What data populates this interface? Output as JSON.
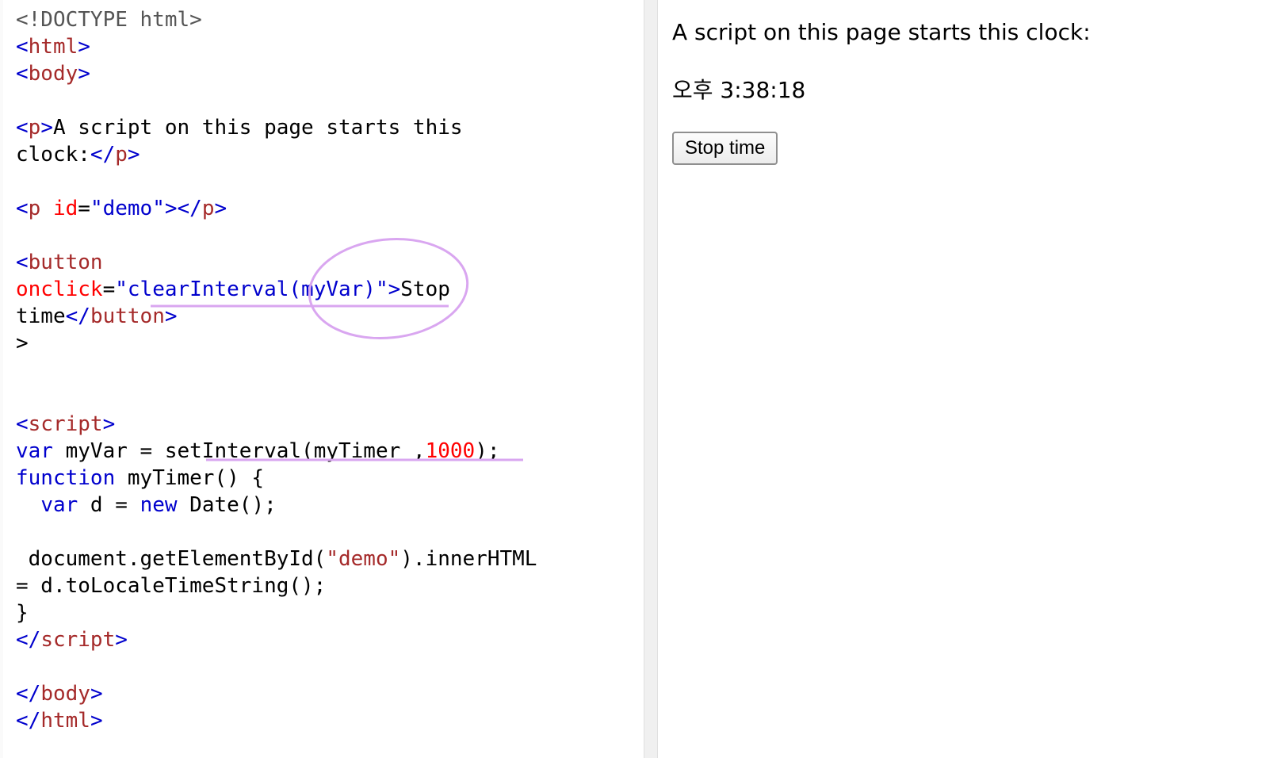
{
  "editor": {
    "lines": [
      [
        {
          "t": "<!DOCTYPE html>",
          "c": "doctype"
        }
      ],
      [
        {
          "t": "<",
          "c": "br"
        },
        {
          "t": "html",
          "c": "tag"
        },
        {
          "t": ">",
          "c": "br"
        }
      ],
      [
        {
          "t": "<",
          "c": "br"
        },
        {
          "t": "body",
          "c": "tag"
        },
        {
          "t": ">",
          "c": "br"
        }
      ],
      [],
      [
        {
          "t": "<",
          "c": "br"
        },
        {
          "t": "p",
          "c": "tag"
        },
        {
          "t": ">",
          "c": "br"
        },
        {
          "t": "A script on this page starts this",
          "c": "plain"
        }
      ],
      [
        {
          "t": "clock:",
          "c": "plain"
        },
        {
          "t": "</",
          "c": "br"
        },
        {
          "t": "p",
          "c": "tag"
        },
        {
          "t": ">",
          "c": "br"
        }
      ],
      [],
      [
        {
          "t": "<",
          "c": "br"
        },
        {
          "t": "p",
          "c": "tag"
        },
        {
          "t": " ",
          "c": "plain"
        },
        {
          "t": "id",
          "c": "attr"
        },
        {
          "t": "=",
          "c": "plain"
        },
        {
          "t": "\"demo\"",
          "c": "val"
        },
        {
          "t": "></",
          "c": "br"
        },
        {
          "t": "p",
          "c": "tag"
        },
        {
          "t": ">",
          "c": "br"
        }
      ],
      [],
      [
        {
          "t": "<",
          "c": "br"
        },
        {
          "t": "button",
          "c": "tag"
        }
      ],
      [
        {
          "t": "onclick",
          "c": "attr"
        },
        {
          "t": "=",
          "c": "plain"
        },
        {
          "t": "\"clearInterval(myVar)\"",
          "c": "val"
        },
        {
          "t": ">",
          "c": "br"
        },
        {
          "t": "Stop",
          "c": "plain"
        }
      ],
      [
        {
          "t": "time",
          "c": "plain"
        },
        {
          "t": "</",
          "c": "br"
        },
        {
          "t": "button",
          "c": "tag"
        },
        {
          "t": ">",
          "c": "br"
        }
      ],
      [
        {
          "t": ">",
          "c": "plain"
        }
      ],
      [],
      [],
      [
        {
          "t": "<",
          "c": "br"
        },
        {
          "t": "script",
          "c": "tag"
        },
        {
          "t": ">",
          "c": "br"
        }
      ],
      [
        {
          "t": "var",
          "c": "kw"
        },
        {
          "t": " myVar = setInterval(myTimer ,",
          "c": "plain"
        },
        {
          "t": "1000",
          "c": "num"
        },
        {
          "t": ");",
          "c": "plain"
        }
      ],
      [
        {
          "t": "function",
          "c": "kw"
        },
        {
          "t": " myTimer() {",
          "c": "plain"
        }
      ],
      [
        {
          "t": "  ",
          "c": "plain"
        },
        {
          "t": "var",
          "c": "kw"
        },
        {
          "t": " d = ",
          "c": "plain"
        },
        {
          "t": "new",
          "c": "kw"
        },
        {
          "t": " Date();",
          "c": "plain"
        }
      ],
      [],
      [
        {
          "t": " document.getElementById(",
          "c": "plain"
        },
        {
          "t": "\"demo\"",
          "c": "str"
        },
        {
          "t": ").innerHTML",
          "c": "plain"
        }
      ],
      [
        {
          "t": "= d.toLocaleTimeString();",
          "c": "plain"
        }
      ],
      [
        {
          "t": "}",
          "c": "plain"
        }
      ],
      [
        {
          "t": "</",
          "c": "br"
        },
        {
          "t": "script",
          "c": "tag"
        },
        {
          "t": ">",
          "c": "br"
        }
      ],
      [],
      [
        {
          "t": "</",
          "c": "br"
        },
        {
          "t": "body",
          "c": "tag"
        },
        {
          "t": ">",
          "c": "br"
        }
      ],
      [
        {
          "t": "</",
          "c": "br"
        },
        {
          "t": "html",
          "c": "tag"
        },
        {
          "t": ">",
          "c": "br"
        }
      ]
    ]
  },
  "result": {
    "intro_text": "A script on this page starts this clock:",
    "clock_text": "오후 3:38:18",
    "stop_button_label": "Stop time"
  },
  "colors": {
    "tag": "#a52a2a",
    "bracket": "#0000cd",
    "attribute": "#ff0000",
    "value": "#0000cd",
    "annotation": "#d9a6f0"
  }
}
